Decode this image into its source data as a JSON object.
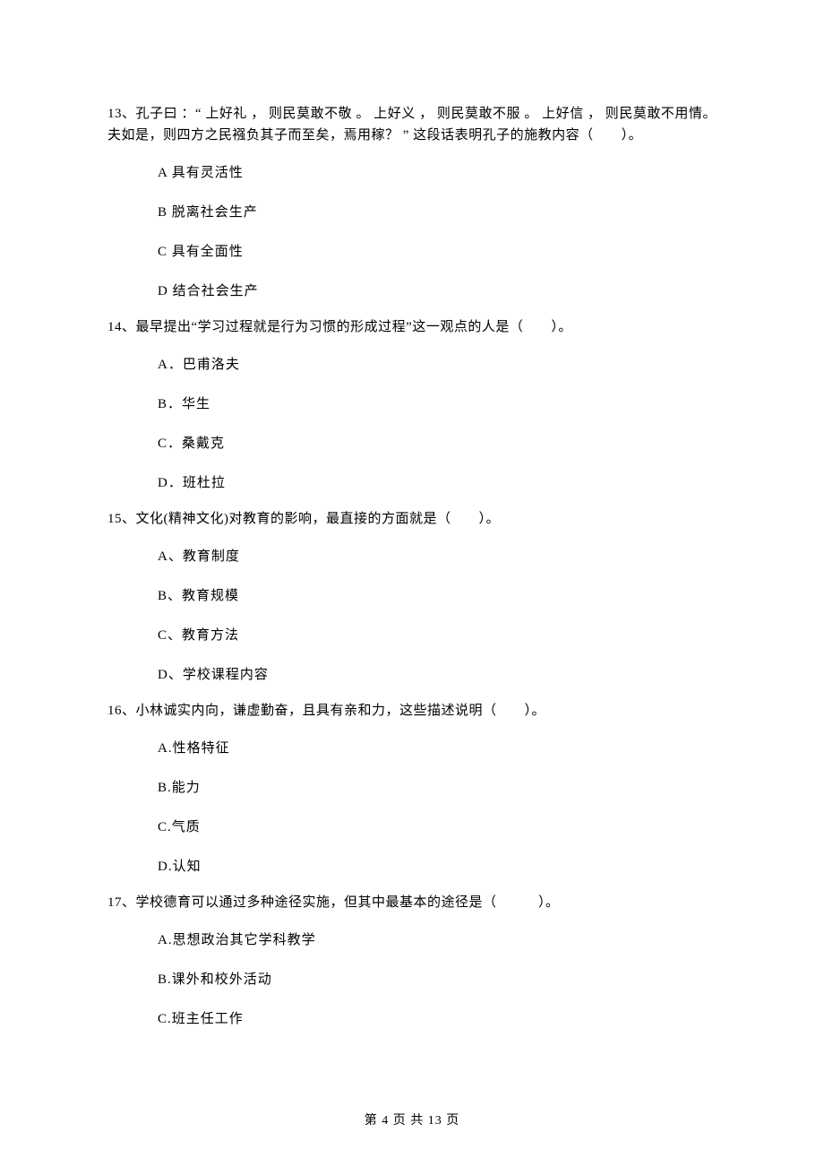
{
  "questions": [
    {
      "num": "13",
      "text": "13、孔子曰 ：“ 上好礼 ， 则民莫敢不敬 。 上好义 ， 则民莫敢不服 。 上好信 ， 则民莫敢不用情。夫如是，则四方之民襁负其子而至矣，焉用稼？ ” 这段话表明孔子的施教内容（　　）。",
      "options": [
        "A 具有灵活性",
        "B 脱离社会生产",
        "C 具有全面性",
        "D 结合社会生产"
      ]
    },
    {
      "num": "14",
      "text": "14、最早提出“学习过程就是行为习惯的形成过程”这一观点的人是（　　）。",
      "options": [
        "A．巴甫洛夫",
        "B．华生",
        "C．桑戴克",
        "D．班杜拉"
      ]
    },
    {
      "num": "15",
      "text": "15、文化(精神文化)对教育的影响，最直接的方面就是（　　）。",
      "options": [
        "A、教育制度",
        "B、教育规模",
        "C、教育方法",
        "D、学校课程内容"
      ]
    },
    {
      "num": "16",
      "text": "16、小林诚实内向，谦虚勤奋，且具有亲和力，这些描述说明（　　）。",
      "options": [
        "A.性格特征",
        "B.能力",
        "C.气质",
        "D.认知"
      ]
    },
    {
      "num": "17",
      "text": "17、学校德育可以通过多种途径实施，但其中最基本的途径是（　　　）。",
      "options": [
        "A.思想政治其它学科教学",
        "B.课外和校外活动",
        "C.班主任工作"
      ]
    }
  ],
  "footer": "第 4 页 共 13 页"
}
